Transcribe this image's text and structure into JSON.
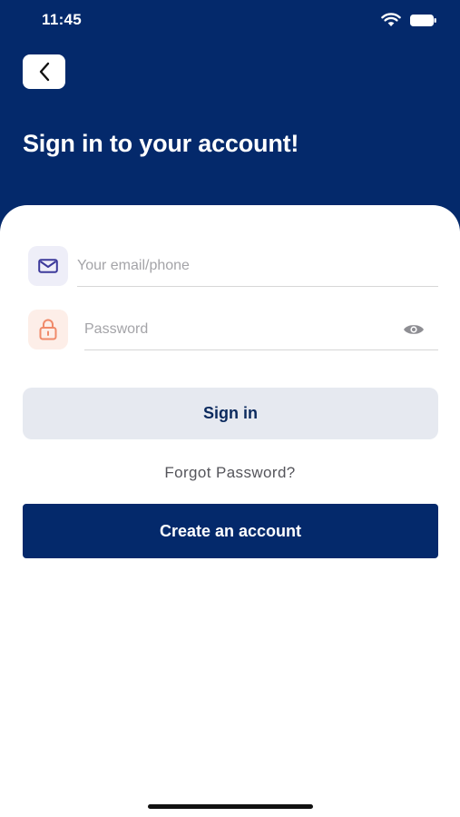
{
  "status_bar": {
    "time": "11:45",
    "icons": [
      "wifi-icon",
      "battery-icon"
    ]
  },
  "header": {
    "back_icon": "chevron-left-icon",
    "title": "Sign in to your account!"
  },
  "form": {
    "email": {
      "icon": "mail-icon",
      "placeholder": "Your email/phone",
      "value": ""
    },
    "password": {
      "icon": "lock-icon",
      "placeholder": "Password",
      "value": "",
      "toggle_icon": "eye-icon"
    },
    "signin_label": "Sign in",
    "forgot_label": "Forgot Password?",
    "create_label": "Create an account"
  },
  "colors": {
    "primary": "#04296b",
    "secondary_button": "#e6e9f0",
    "mail_icon": "#3d3a9b",
    "lock_icon": "#f08a6a"
  }
}
